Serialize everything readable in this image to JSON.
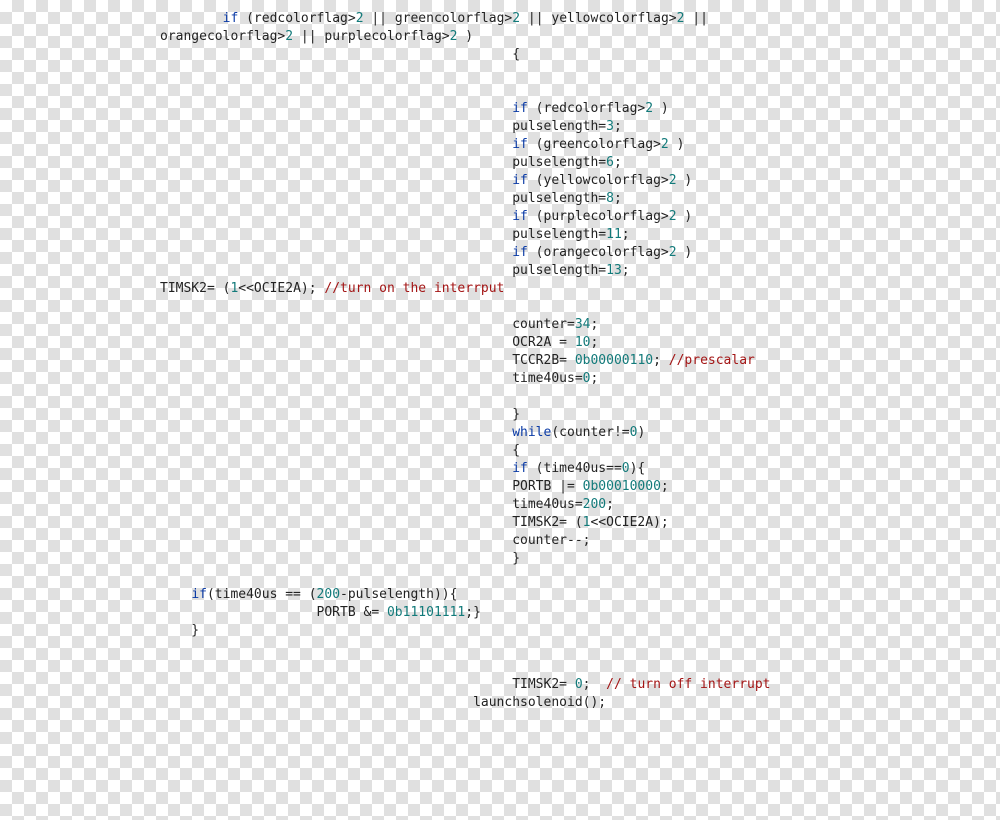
{
  "code": {
    "t01a": "        ",
    "kw_if": "if",
    "t01b": " (redcolorflag>",
    "n2": "2",
    "t01c": " || greencolorflag>",
    "t01d": " || yellowcolorflag>",
    "t01e": " ||",
    "t02": "orangecolorflag>",
    "t02b": " || purplecolorflag>",
    "t02c": " )",
    "t03": "                                             {",
    "t05a": "                                             ",
    "t05b": " (redcolorflag>",
    "t05c": " )",
    "t06": "                                             pulselength=",
    "n3": "3",
    "semi": ";",
    "t07b": " (greencolorflag>",
    "t08n": "6",
    "t09b": " (yellowcolorflag>",
    "t10n": "8",
    "t11b": " (purplecolorflag>",
    "t12n": "11",
    "t13b": " (orangecolorflag>",
    "t14n": "13",
    "t15a": "TIMSK2= (",
    "n1": "1",
    "t15b": "<<OCIE2A); ",
    "c15": "//turn on the interrput",
    "t17": "                                             counter=",
    "n34": "34",
    "t18": "                                             OCR2A = ",
    "n10": "10",
    "t19": "                                             TCCR2B= ",
    "b06": "0b00000110",
    "t19c": "; ",
    "c19": "//prescalar",
    "t20": "                                             time40us=",
    "n0": "0",
    "t22": "                                             }",
    "kw_while": "while",
    "t23b": "(counter!=",
    "t23c": ")",
    "t24": "                                             {",
    "t25b": " (time40us==",
    "t25c": "){",
    "t26": "                                             PORTB |= ",
    "b10": "0b00010000",
    "t27": "                                             time40us=",
    "n200": "200",
    "t28": "                                             TIMSK2= (",
    "t29": "                                             counter--;",
    "t30": "                                             }",
    "t32a": "    ",
    "t32b": "(time40us == (",
    "t32c": "-pulselength)){",
    "t33": "                    PORTB &= ",
    "b_ef": "0b11101111",
    "t33b": ";}",
    "t34": "    }",
    "t37": "                                             TIMSK2= ",
    "t37b": ";  ",
    "c37": "// turn off interrupt",
    "t38": "                                        launchsolenoid();"
  }
}
